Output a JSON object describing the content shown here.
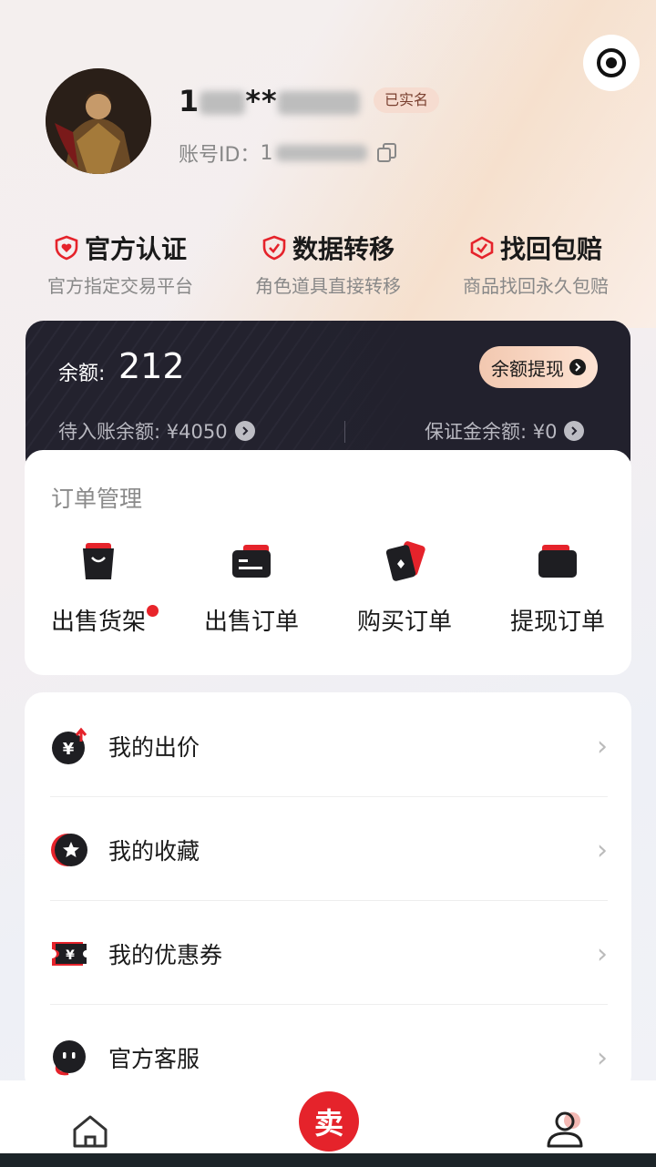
{
  "profile": {
    "name_prefix": "1",
    "name_stars": "**",
    "verified_badge": "已实名",
    "account_label": "账号ID：",
    "account_prefix": "1"
  },
  "features": [
    {
      "title": "官方认证",
      "subtitle": "官方指定交易平台",
      "icon": "shield-heart-icon"
    },
    {
      "title": "数据转移",
      "subtitle": "角色道具直接转移",
      "icon": "shield-check-icon"
    },
    {
      "title": "找回包赔",
      "subtitle": "商品找回永久包赔",
      "icon": "shield-check-icon"
    }
  ],
  "wallet": {
    "balance_label": "余额:",
    "balance_value": "212",
    "withdraw_label": "余额提现",
    "pending_label": "待入账余额: ¥4050",
    "deposit_label": "保证金余额: ¥0"
  },
  "orders": {
    "title": "订单管理",
    "items": [
      {
        "label": "出售货架",
        "icon": "shopping-bag-icon",
        "has_dot": true
      },
      {
        "label": "出售订单",
        "icon": "card-icon"
      },
      {
        "label": "购买订单",
        "icon": "cards-icon"
      },
      {
        "label": "提现订单",
        "icon": "wallet-icon"
      }
    ]
  },
  "menu": {
    "items": [
      {
        "label": "我的出价",
        "icon": "yen-up-icon"
      },
      {
        "label": "我的收藏",
        "icon": "star-icon"
      },
      {
        "label": "我的优惠券",
        "icon": "coupon-icon"
      },
      {
        "label": "官方客服",
        "icon": "service-icon"
      }
    ]
  },
  "tabbar": {
    "sell_label": "卖"
  },
  "colors": {
    "accent_red": "#e5232b",
    "wallet_bg": "#23222e",
    "badge_bg": "#f6dcd0"
  }
}
